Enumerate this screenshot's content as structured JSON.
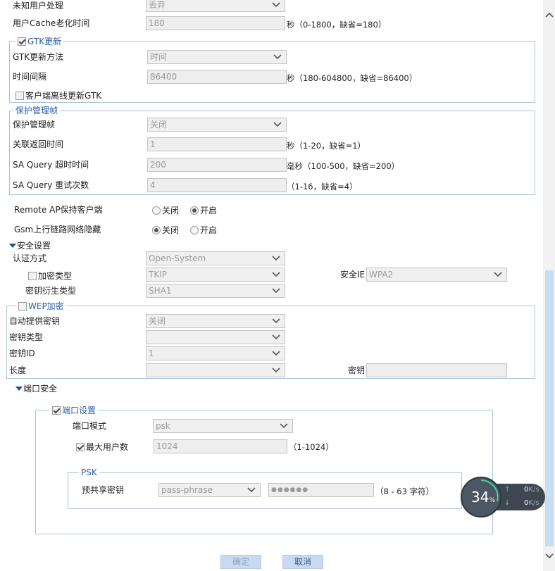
{
  "top": {
    "unknown_user_label": "未知用户处理",
    "unknown_user_value": "丢弃",
    "cache_label": "用户Cache老化时间",
    "cache_value": "180",
    "cache_hint": "秒（0-1800，缺省=180）"
  },
  "gtk": {
    "legend": "GTK更新",
    "checked": true,
    "method_label": "GTK更新方法",
    "method_value": "时间",
    "interval_label": "时间间隔",
    "interval_value": "86400",
    "interval_hint": "秒（180-604800，缺省=86400）",
    "offline_label": "客户端离线更新GTK"
  },
  "pmf": {
    "legend": "保护管理帧",
    "pmf_label": "保护管理帧",
    "pmf_value": "关闭",
    "assoc_label": "关联返回时间",
    "assoc_value": "1",
    "assoc_hint": "秒（1-20，缺省=1）",
    "sa_timeout_label": "SA Query 超时时间",
    "sa_timeout_value": "200",
    "sa_timeout_hint": "毫秒（100-500，缺省=200）",
    "sa_retry_label": "SA Query 重试次数",
    "sa_retry_value": "4",
    "sa_retry_hint": "（1-16，缺省=4）"
  },
  "options": {
    "remote_ap_label": "Remote AP保持客户端",
    "gsm_label": "Gsm上行链路网络隐藏",
    "off_label": "关闭",
    "on_label": "开启",
    "remote_ap_selected": "on",
    "gsm_selected": "off"
  },
  "security": {
    "title": "安全设置",
    "auth_label": "认证方式",
    "auth_value": "Open-System",
    "enc_label": "加密类型",
    "enc_value": "TKIP",
    "ie_label": "安全IE",
    "ie_value": "WPA2",
    "kdf_label": "密钥衍生类型",
    "kdf_value": "SHA1"
  },
  "wep": {
    "legend": "WEP加密",
    "auto_key_label": "自动提供密钥",
    "auto_key_value": "关闭",
    "key_type_label": "密钥类型",
    "key_type_value": "",
    "key_id_label": "密钥ID",
    "key_id_value": "1",
    "length_label": "长度",
    "length_value": "",
    "key_label": "密钥",
    "key_value": ""
  },
  "port_security": {
    "title": "端口安全",
    "legend": "端口设置",
    "mode_label": "端口模式",
    "mode_value": "psk",
    "max_users_label": "最大用户数",
    "max_users_value": "1024",
    "max_users_hint": "（1-1024）",
    "psk_legend": "PSK",
    "psk_label": "预共享密钥",
    "psk_type_value": "pass-phrase",
    "psk_value": "●●●●●●",
    "psk_hint": "（8 - 63 字符）"
  },
  "buttons": {
    "ok": "确定",
    "cancel": "取消"
  },
  "speed_widget": {
    "percent": "34",
    "percent_unit": "%",
    "up_value": "0",
    "down_value": "0",
    "unit": "K/s"
  }
}
